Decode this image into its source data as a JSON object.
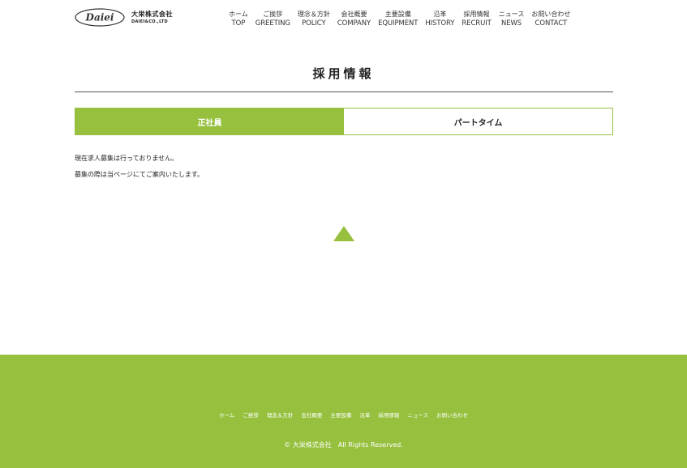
{
  "header": {
    "logo_script": "Daiei",
    "logo_jp": "大栄株式会社",
    "logo_en": "DAIEI&CO.,LTD",
    "nav": [
      {
        "jp": "ホーム",
        "en": "TOP"
      },
      {
        "jp": "ご挨拶",
        "en": "GREETING"
      },
      {
        "jp": "理念＆方針",
        "en": "POLICY"
      },
      {
        "jp": "会社概要",
        "en": "COMPANY"
      },
      {
        "jp": "主要設備",
        "en": "EQUIPMENT"
      },
      {
        "jp": "沿革",
        "en": "HISTORY"
      },
      {
        "jp": "採用情報",
        "en": "RECRUIT"
      },
      {
        "jp": "ニュース",
        "en": "NEWS"
      },
      {
        "jp": "お問い合わせ",
        "en": "CONTACT"
      }
    ]
  },
  "main": {
    "title": "採用情報",
    "tabs": [
      {
        "label": "正社員",
        "active": true
      },
      {
        "label": "パートタイム",
        "active": false
      }
    ],
    "notice_1": "現在求人募集は行っておりません。",
    "notice_2": "募集の際は当ページにてご案内いたします。"
  },
  "footer": {
    "links": [
      "ホーム",
      "ご挨拶",
      "理念＆方針",
      "会社概要",
      "主要設備",
      "沿革",
      "採用情報",
      "ニュース",
      "お問い合わせ"
    ],
    "copyright": "© 大栄株式会社　All Rights Reserved."
  },
  "colors": {
    "accent": "#96c03e",
    "text": "#222222",
    "background": "#ffffff"
  },
  "icons": {
    "logo": "daiei-oval-logo",
    "page_top": "triangle-up-icon"
  }
}
